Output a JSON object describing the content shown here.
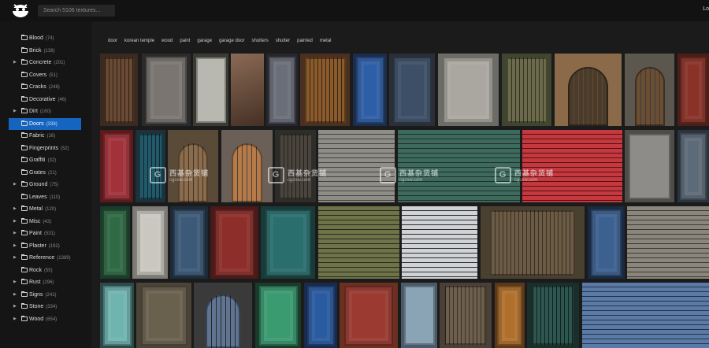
{
  "header": {
    "search_placeholder": "Search 5106 textures...",
    "login_label": "Lo"
  },
  "sidebar": {
    "items": [
      {
        "label": "Blood",
        "count": "(74)",
        "expandable": false
      },
      {
        "label": "Brick",
        "count": "(138)",
        "expandable": false
      },
      {
        "label": "Concrete",
        "count": "(201)",
        "expandable": true
      },
      {
        "label": "Covers",
        "count": "(51)",
        "expandable": false
      },
      {
        "label": "Cracks",
        "count": "(248)",
        "expandable": false
      },
      {
        "label": "Decorative",
        "count": "(46)",
        "expandable": false
      },
      {
        "label": "Dirt",
        "count": "(160)",
        "expandable": true
      },
      {
        "label": "Doors",
        "count": "(338)",
        "expandable": false,
        "active": true
      },
      {
        "label": "Fabric",
        "count": "(16)",
        "expandable": false
      },
      {
        "label": "Fingerprints",
        "count": "(52)",
        "expandable": false
      },
      {
        "label": "Graffiti",
        "count": "(32)",
        "expandable": false
      },
      {
        "label": "Grates",
        "count": "(21)",
        "expandable": false
      },
      {
        "label": "Ground",
        "count": "(75)",
        "expandable": true
      },
      {
        "label": "Leaves",
        "count": "(110)",
        "expandable": false
      },
      {
        "label": "Metal",
        "count": "(120)",
        "expandable": true
      },
      {
        "label": "Misc",
        "count": "(43)",
        "expandable": true
      },
      {
        "label": "Paint",
        "count": "(531)",
        "expandable": true
      },
      {
        "label": "Plaster",
        "count": "(192)",
        "expandable": true
      },
      {
        "label": "Reference",
        "count": "(1389)",
        "expandable": true
      },
      {
        "label": "Rock",
        "count": "(55)",
        "expandable": false
      },
      {
        "label": "Rust",
        "count": "(296)",
        "expandable": true
      },
      {
        "label": "Signs",
        "count": "(241)",
        "expandable": true
      },
      {
        "label": "Stone",
        "count": "(334)",
        "expandable": true
      },
      {
        "label": "Wood",
        "count": "(654)",
        "expandable": true
      }
    ]
  },
  "tags": [
    "door",
    "korean temple",
    "wood",
    "paint",
    "garage",
    "garage door",
    "shutters",
    "shutter",
    "painted",
    "metal"
  ],
  "watermark": {
    "brand": "西基杂货铺",
    "site": "cgcsw.com",
    "letter": "G"
  },
  "colors": {
    "accent": "#1565c0",
    "background": "#1a1a1a",
    "sidebar": "#151515"
  }
}
